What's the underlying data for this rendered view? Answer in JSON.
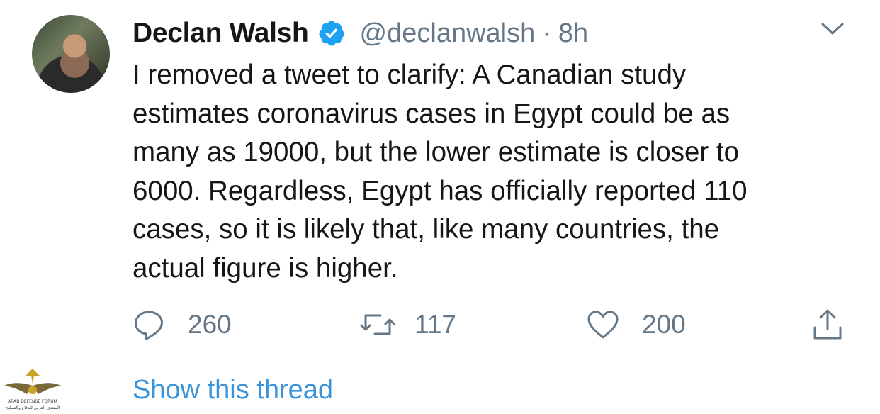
{
  "tweet": {
    "author_name": "Declan Walsh",
    "handle": "@declanwalsh",
    "separator": "·",
    "time": "8h",
    "text": "I removed a tweet to clarify: A Canadian study\nestimates coronavirus cases in Egypt could be as\nmany as 19000, but the lower estimate is closer to\n6000. Regardless, Egypt has officially reported 110\ncases, so it is likely that, like many countries, the\nactual figure is higher.",
    "verified": true
  },
  "actions": {
    "reply_count": "260",
    "retweet_count": "117",
    "like_count": "200"
  },
  "thread_link": "Show this thread",
  "watermark": {
    "line1": "ARAB DEFENSE FORUM",
    "line2": "المنتدى العربي للدفاع والتسليح"
  },
  "icons": {
    "verified": "verified-badge-icon",
    "menu": "chevron-down-icon",
    "reply": "reply-icon",
    "retweet": "retweet-icon",
    "like": "heart-icon",
    "share": "share-icon"
  },
  "colors": {
    "accent": "#3b94d9",
    "verified_blue": "#1da1f2",
    "secondary_text": "#657786",
    "primary_text": "#14171a"
  }
}
